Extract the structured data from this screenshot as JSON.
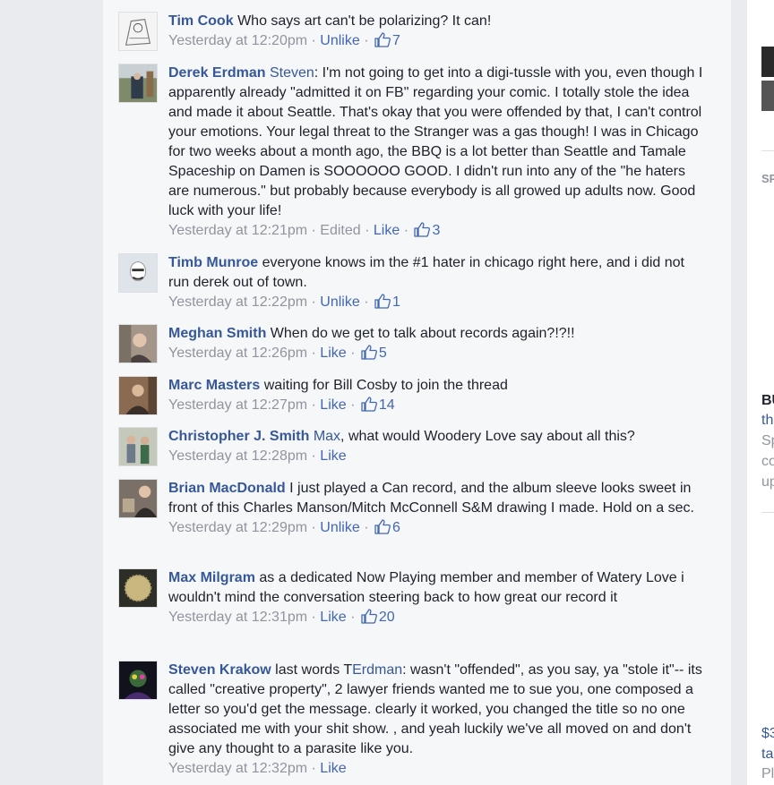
{
  "comments": [
    {
      "author": "Tim Cook",
      "text": "Who says art can't be polarizing? It can!",
      "time": "Yesterday at 12:20pm",
      "action": "Unlike",
      "likes": "7"
    },
    {
      "author": "Derek Erdman",
      "mention": "Steven",
      "text": ": I'm not going to get into a digi-tussle with you, even though I apparently already \"admitted it on FB\" regarding your comic. I totally stole the idea and made it about Seattle. That's okay that you were offended by that, I can't control your emotions. Your legal threat to the Stranger was a gas though! I was in Chicago for two weeks about a month ago, the BBQ is a lot better than Seattle and Tamale Spaceship on Damen is SOOOOOO GOOD. I didn't run into any of the \"he haters are numerous.\" but probably because everybody is all growed up adults now. Good luck with your life!",
      "time": "Yesterday at 12:21pm",
      "edited": "Edited",
      "action": "Like",
      "likes": "3"
    },
    {
      "author": "Timb Munroe",
      "text": "everyone knows im the #1 hater in chicago right here, and i did not run derek out of town.",
      "time": "Yesterday at 12:22pm",
      "action": "Unlike",
      "likes": "1"
    },
    {
      "author": "Meghan Smith",
      "text": "When do we get to talk about records again?!?!!",
      "time": "Yesterday at 12:26pm",
      "action": "Like",
      "likes": "5"
    },
    {
      "author": "Marc Masters",
      "text": "waiting for Bill Cosby to join the thread",
      "time": "Yesterday at 12:27pm",
      "action": "Like",
      "likes": "14"
    },
    {
      "author": "Christopher J. Smith",
      "mention": "Max",
      "text": ", what would Woodery Love say about all this?",
      "time": "Yesterday at 12:28pm",
      "action": "Like"
    },
    {
      "author": "Brian MacDonald",
      "text": "I just played a Can record, and the album sleeve looks sweet in front of this Charles Manson/Mitch McConnell S&M drawing I made. Hold on a sec.",
      "time": "Yesterday at 12:29pm",
      "action": "Unlike",
      "likes": "6"
    },
    {
      "author": "Max Milgram",
      "text": "as a dedicated Now Playing member and member of Watery Love i wouldn't mind the conversation steering back to how great our record it",
      "time": "Yesterday at 12:31pm",
      "action": "Like",
      "likes": "20"
    },
    {
      "author": "Steven Krakow",
      "text_before": "last words T",
      "mention": "Erdman",
      "text": ": wasn't \"offended\", as you say, ya \"stole it\"-- its called \"creative property\", 2 lawyer friends wanted me to sue you, one composed a letter so you'd get the message. clearly it worked, you changed the title so no one associated me with your shit show. , and yeah luckily we've all moved on and don't give any thought to a parasite like you.",
      "time": "Yesterday at 12:32pm",
      "action": "Like"
    }
  ],
  "right_column": {
    "fragments": [
      "SP",
      "BU",
      "th",
      "Sp",
      "co",
      "up",
      "$3",
      "ta",
      "Pl"
    ]
  },
  "colors": {
    "link": "#365899",
    "meta": "#90949c",
    "action": "#4267b2"
  }
}
